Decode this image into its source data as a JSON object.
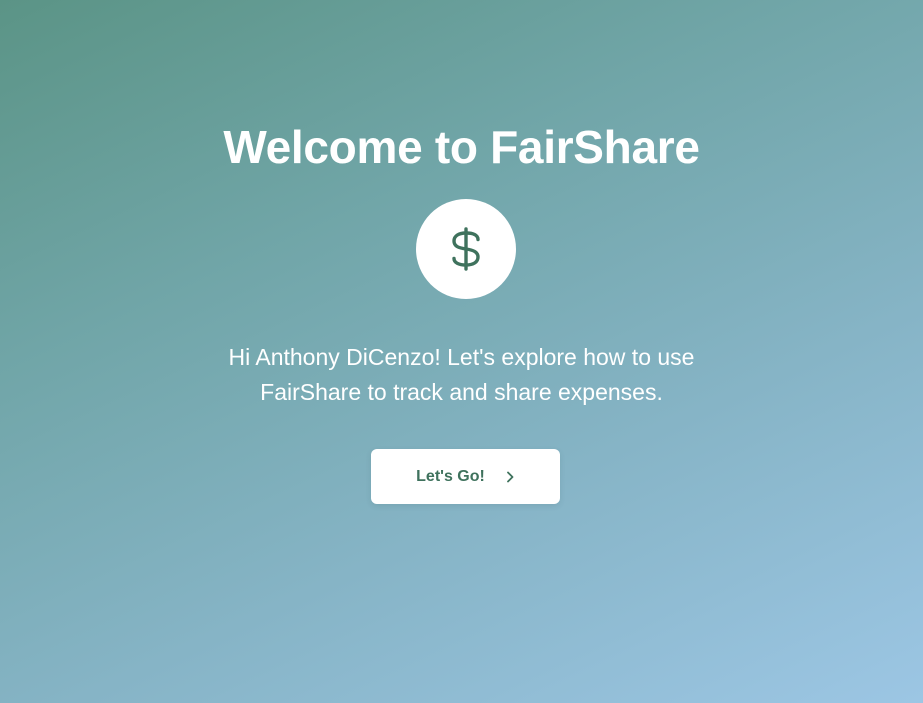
{
  "welcome": {
    "title": "Welcome to FairShare",
    "logo_icon": "dollar-sign-icon",
    "message": "Hi Anthony DiCenzo! Let's explore how to use FairShare to track and share expenses.",
    "cta_label": "Let's Go!",
    "cta_icon": "chevron-right-icon"
  },
  "colors": {
    "background_start": "#5b9486",
    "background_end": "#9cc6e4",
    "accent": "#3f725d",
    "text": "#ffffff"
  }
}
